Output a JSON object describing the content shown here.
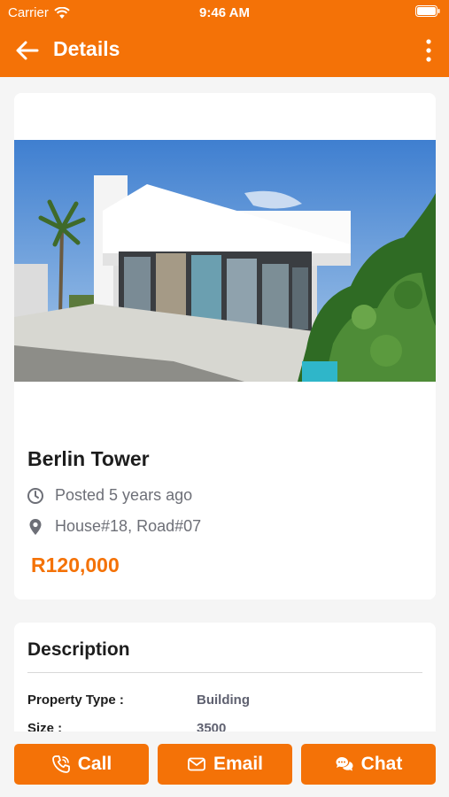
{
  "status_bar": {
    "carrier": "Carrier",
    "time": "9:46 AM"
  },
  "header": {
    "title": "Details"
  },
  "property": {
    "name": "Berlin Tower",
    "posted": "Posted 5 years ago",
    "address": "House#18, Road#07",
    "price": "R120,000"
  },
  "description": {
    "title": "Description",
    "rows": [
      {
        "label": "Property Type :",
        "value": "Building"
      },
      {
        "label": "Size :",
        "value": "3500"
      }
    ]
  },
  "actions": {
    "call": "Call",
    "email": "Email",
    "chat": "Chat"
  },
  "colors": {
    "accent": "#f47207",
    "background": "#f5f5f5",
    "card": "#ffffff"
  },
  "icons": [
    "wifi-icon",
    "battery-icon",
    "back-arrow-icon",
    "more-vertical-icon",
    "clock-icon",
    "location-pin-icon",
    "phone-icon",
    "mail-icon",
    "chat-bubbles-icon"
  ]
}
